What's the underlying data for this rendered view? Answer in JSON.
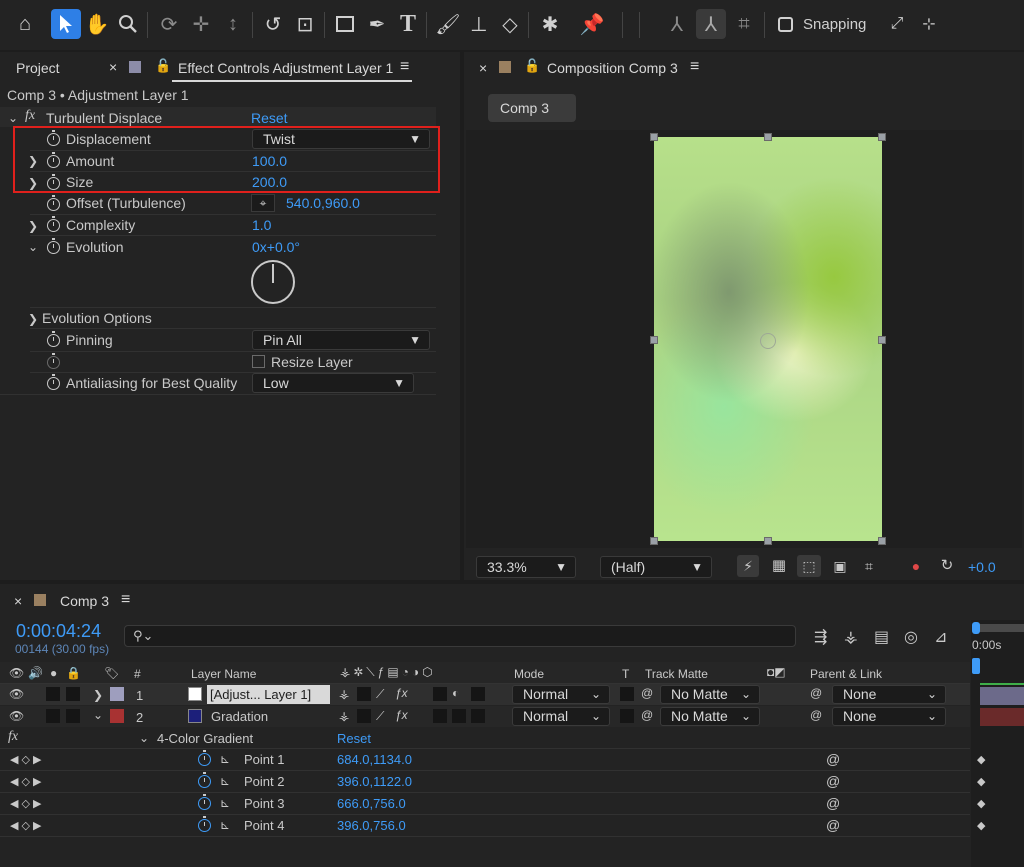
{
  "toolbar": {
    "snapping_label": "Snapping"
  },
  "left_panel": {
    "tab_project": "Project",
    "tab_effect_controls": "Effect Controls Adjustment Layer 1",
    "breadcrumb": "Comp 3 • Adjustment Layer 1",
    "effect_name": "Turbulent Displace",
    "reset": "Reset",
    "properties": {
      "displacement": {
        "label": "Displacement",
        "value": "Twist"
      },
      "amount": {
        "label": "Amount",
        "value": "100.0"
      },
      "size": {
        "label": "Size",
        "value": "200.0"
      },
      "offset": {
        "label": "Offset (Turbulence)",
        "value": "540.0,960.0"
      },
      "complexity": {
        "label": "Complexity",
        "value": "1.0"
      },
      "evolution": {
        "label": "Evolution",
        "value": "0x+0.0°"
      },
      "evolution_options": {
        "label": "Evolution Options"
      },
      "pinning": {
        "label": "Pinning",
        "value": "Pin All"
      },
      "resize_layer": {
        "label": "Resize Layer"
      },
      "antialiasing": {
        "label": "Antialiasing for Best Quality",
        "value": "Low"
      }
    }
  },
  "comp_panel": {
    "tab_title": "Composition Comp 3",
    "comp_button": "Comp 3",
    "zoom": "33.3%",
    "resolution": "(Half)",
    "exposure": "+0.0"
  },
  "timeline": {
    "tab_title": "Comp 3",
    "timecode": "0:00:04:24",
    "frame_info": "00144 (30.00 fps)",
    "ruler_label": "0:00s",
    "headers": {
      "number": "#",
      "layer_name": "Layer Name",
      "mode": "Mode",
      "t": "T",
      "track_matte": "Track Matte",
      "parent_link": "Parent & Link"
    },
    "layers": [
      {
        "number": "1",
        "name": "[Adjust... Layer 1]",
        "mode": "Normal",
        "matte": "No Matte",
        "parent": "None",
        "color": "#9e9ebe",
        "swatch": "#ffffff"
      },
      {
        "number": "2",
        "name": "Gradation",
        "mode": "Normal",
        "matte": "No Matte",
        "parent": "None",
        "color": "#a83232",
        "swatch": "#1c1f7a"
      }
    ],
    "effect_name": "4-Color Gradient",
    "effect_reset": "Reset",
    "points": [
      {
        "label": "Point 1",
        "value": "684.0,1134.0"
      },
      {
        "label": "Point 2",
        "value": "396.0,1122.0"
      },
      {
        "label": "Point 3",
        "value": "666.0,756.0"
      },
      {
        "label": "Point 4",
        "value": "396.0,756.0"
      }
    ]
  }
}
